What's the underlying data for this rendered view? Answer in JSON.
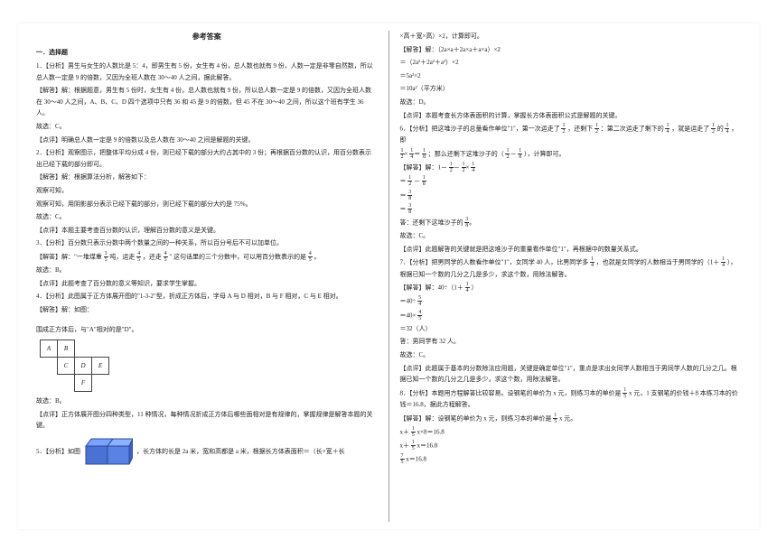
{
  "title": "参考答案",
  "sectionHead": "一．选择题",
  "left": {
    "q1": {
      "analysis": "1．【分析】男生与女生的人数比是 5：4，即男生有 5 份，女生有 4 份，总人数也就有 9 份，人数一定是非零自然数，所以总人数一定是 9 的倍数，又因为全班人数在 30～40 人之间，据此解答。",
      "solve": "【解答】解：根据题意，男生有 5 份时，女生有 4 份，总人数也就有 9 份，所以总人数一定是 9 的倍数，又因为全班人数在 30～40 人之间，A、B、C、D 四个选项中只有 36 和 45 是 9 的倍数，但 45 不在 30～40 之间，所以这个班有学生 36 人。",
      "answer": "故选：C。",
      "point": "【点评】明确总人数一定是 9 的倍数以及总人数在 30～40 之间是解题的关键。"
    },
    "q2": {
      "analysis": "2．【分析】观察图示，把整体平均分成 4 份，则已经下载的部分大约占其中的 3 份；再根据百分数的认识，用百分数表示出已经下载的部分即可。",
      "solve": "【解答】解：根据算法分析，解答如下：",
      "line1": "观察可知，",
      "line2": "观察可知，用阴影部分表示已经下载的部分，则已经下载的部分大约是 75%。",
      "answer": "故选：C。",
      "point": "【点评】本题主要考查百分数的认识，理解百分数的意义是关键。"
    },
    "q3": {
      "analysis": "3．【分析】百分数只表示分数中两个数量之间的一种关系，所以百分号后不可以加单位。",
      "solve1": "【解答】解：\"一堆煤重",
      "solve2": "吨，运走",
      "solve3": "，还走",
      "solve4": "\" 这句话里的三个分数中，可以用百分数表示的是",
      "solve5": "。",
      "answerLabel": "故选：B。",
      "pointLabel": "【点评】此题考查了百分数的意义等知识，要求学生掌握。"
    },
    "q4": {
      "analysis": "4．【分析】此图属于正方体展开图的\"1-3-2\"型，折成正方体后，字母 A 与 D 相对，B 与 F 相对，C 与 E 相对。",
      "solve": "【解答】解：如图：",
      "afterNet": "围成正方体后，与\"A\"相对的是\"D\"。",
      "answer": "故选：B。",
      "point": "【点评】正方体展开图分四种类型，11 种情况，每种情况折成正方体后哪些面相对是有规律的，掌握规律是解答本题的关键。"
    },
    "q5": {
      "prefix": "5．【分析】如图",
      "after": "，长方体的长是 2a 米，宽和高都是 a 米，根据长方体表面积＝（长×宽＋长"
    }
  },
  "right": {
    "cont5": {
      "l1": "×高＋宽×高）×2，计算即可。",
      "solve": "【解答】解：（2a×a＋2a×a＋a×a）×2",
      "e1": "＝（2a²＋2a²＋a²）×2",
      "e2": "＝5a²×2",
      "e3": "＝10a²（平方米）",
      "answer": "故选：D。",
      "point": "【点评】本题考查长方体表面积的计算，掌握长方体表面积公式是解题的关键。"
    },
    "q6": {
      "analysis1": "6．【分析】把这堆沙子的总量看作单位\"1\"，第一次运走了",
      "analysis2": "，还剩下",
      "analysis3": "：第二次运走了剩下的",
      "analysis4": "，就是运走了",
      "analysis5": "的",
      "analysis6": "，即",
      "analysisEnd": "；那么还剩下这堆沙子的（",
      "analysisEnd2": "），计算即可。",
      "solveLabel": "【解答】解：1－",
      "eq1a": "＝",
      "eq1b": "－",
      "eq2": "＝",
      "eq3": "＝",
      "ansLine": "答：还剩下这堆沙子的",
      "answer": "故选：C。",
      "point": "【点评】此题解答的关键就是把这堆沙子的重量看作单位\"1\"，再根据中的数量关系式。"
    },
    "q7": {
      "analysis1": "7．【分析】把男同学的人数看作单位\"1\"，女同学 40 人，比男同学多",
      "analysis2": "，也就是女同学的人数相当于男同学的（1＋",
      "analysis3": "），根据已知一个数的几分之几是多少，求这个数，用除法解答。",
      "solveLabel": "【解答】解：40÷（1＋",
      "solveEnd": "）",
      "e1a": "＝40÷",
      "e2a": "＝40×",
      "e3": "＝32（人）",
      "ansLine": "答：男同学有 32 人。",
      "answer": "故选：C。",
      "point": "【点评】此题属于基本的分数除法应用题，关键是确定单位\"1\"，重点是求出女同学人数相当于男同学人数的几分之几。根据已知一个数的几分之几是多少，求这个数，用除法解答。"
    },
    "q8": {
      "analysis1": "8．【分析】本题用方程解答比较容易。设钢笔的单价为 x 元，则练习本的单价是",
      "analysis2": "x 元，1 支钢笔的价钱＋8 本练习本的价钱＝16.8，据此方程解答。",
      "solveLabel": "【解答】解：设钢笔的单价为 x 元，则练习本的单价是",
      "solveEnd": "x 元。",
      "eq1a": "x＋",
      "eq1b": "x×8＝16.8",
      "eq2a": "x＋",
      "eq2b": "x＝16.8",
      "eq3a": "",
      "eq3b": "x＝16.8"
    }
  },
  "frac": {
    "f3_5": {
      "n": "3",
      "d": "5"
    },
    "f4_5": {
      "n": "4",
      "d": "5"
    },
    "f1_2": {
      "n": "1",
      "d": "2"
    },
    "f1_4": {
      "n": "1",
      "d": "4"
    },
    "f1_8": {
      "n": "1",
      "d": "8"
    },
    "f3_8": {
      "n": "3",
      "d": "8"
    },
    "f5_4": {
      "n": "5",
      "d": "4"
    },
    "f4_5b": {
      "n": "4",
      "d": "5"
    },
    "f1_5": {
      "n": "1",
      "d": "5"
    },
    "f7_5": {
      "n": "7",
      "d": "5"
    }
  },
  "net": {
    "A": "A",
    "B": "B",
    "C": "C",
    "D": "D",
    "E": "E",
    "F": "F"
  }
}
